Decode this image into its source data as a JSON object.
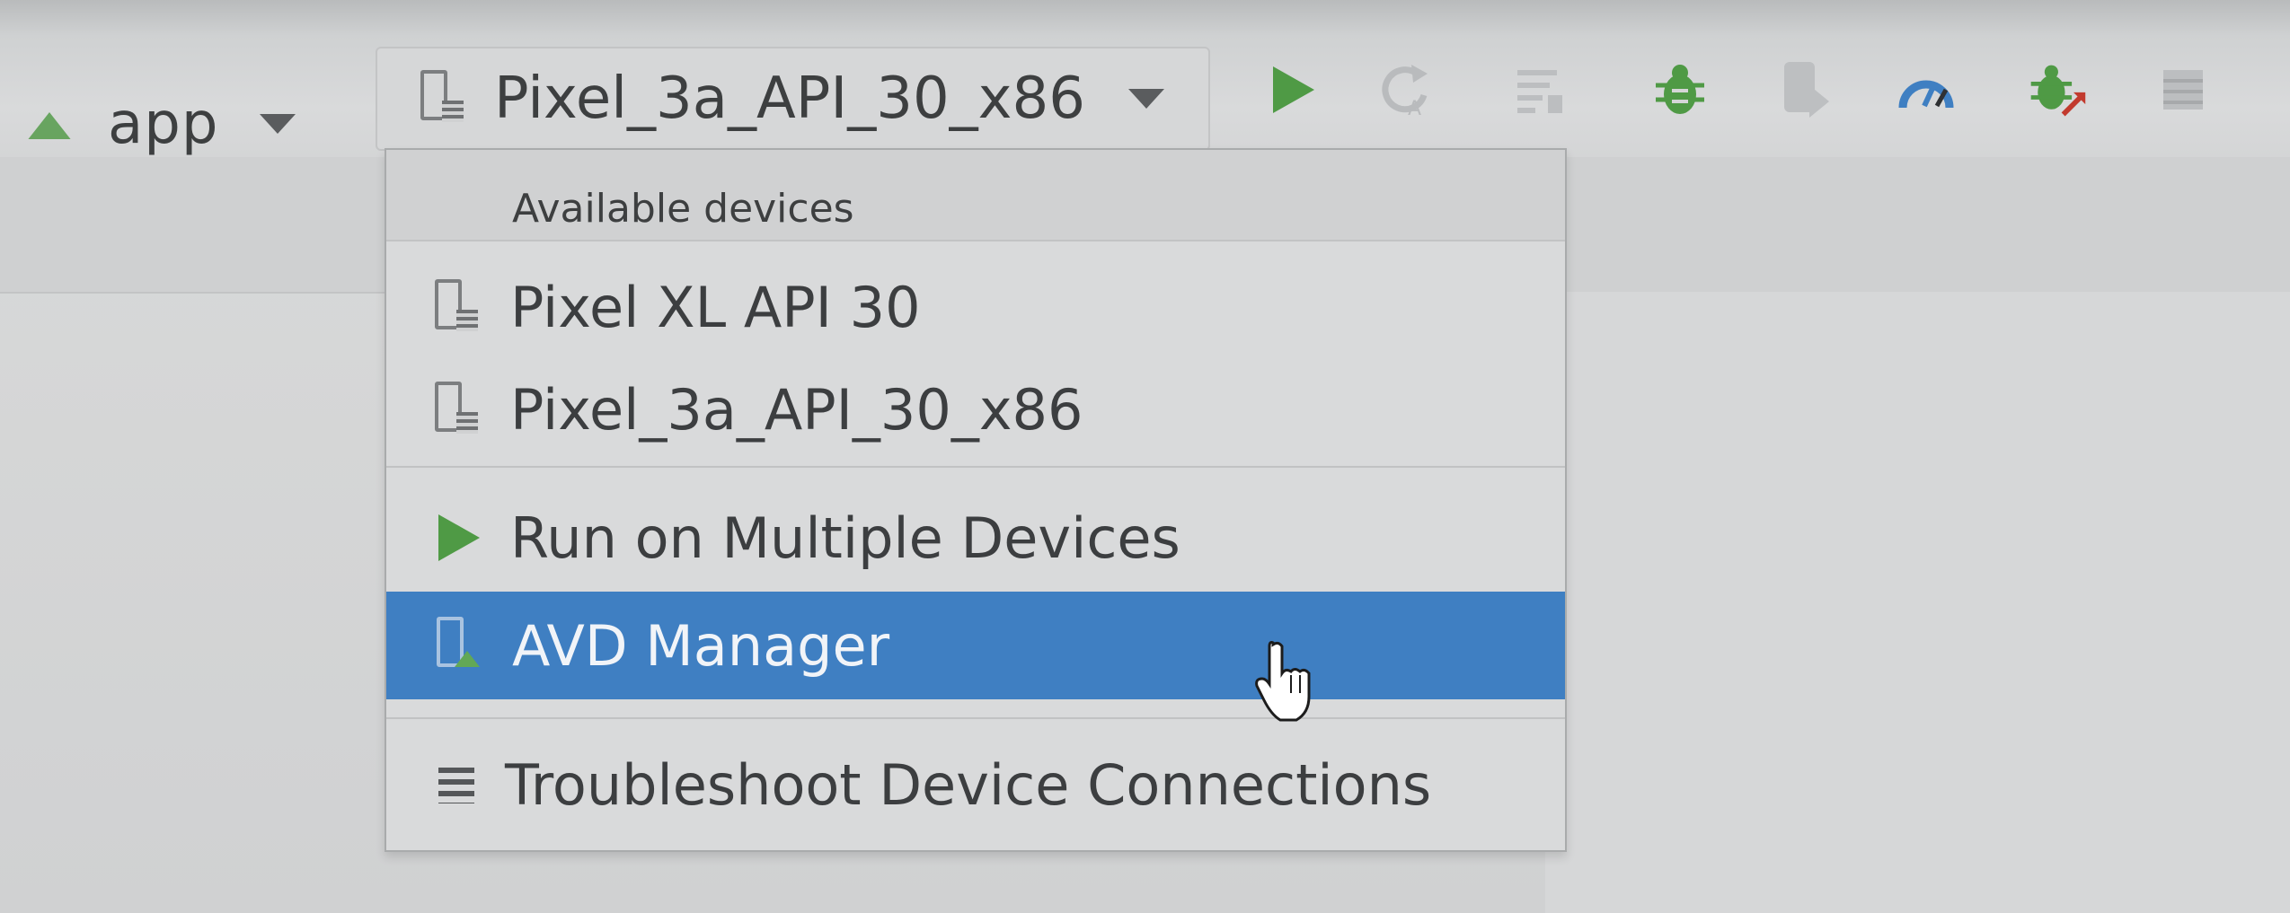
{
  "toolbar": {
    "run_config": {
      "label": "app",
      "icon": "android-icon"
    },
    "device_selector": {
      "label": "Pixel_3a_API_30_x86",
      "icon": "phone-icon"
    },
    "icons": [
      {
        "name": "run-icon",
        "color": "#4f9a45"
      },
      {
        "name": "apply-changes-icon"
      },
      {
        "name": "apply-code-changes-icon"
      },
      {
        "name": "debug-icon",
        "color": "#4f9a45"
      },
      {
        "name": "profile-icon"
      },
      {
        "name": "attach-debugger-icon",
        "color": "#3f7fc2"
      },
      {
        "name": "attach-debugger-bug-icon",
        "color": "#4f9a45"
      },
      {
        "name": "stop-icon"
      }
    ]
  },
  "dropdown": {
    "header": "Available devices",
    "devices": [
      {
        "label": "Pixel XL API 30"
      },
      {
        "label": "Pixel_3a_API_30_x86"
      }
    ],
    "run_multiple": "Run on Multiple Devices",
    "avd_manager": "AVD Manager",
    "troubleshoot": "Troubleshoot Device Connections"
  },
  "colors": {
    "selection": "#3f7fc2",
    "android_green": "#5c9e52",
    "run_green": "#4f9a45"
  }
}
